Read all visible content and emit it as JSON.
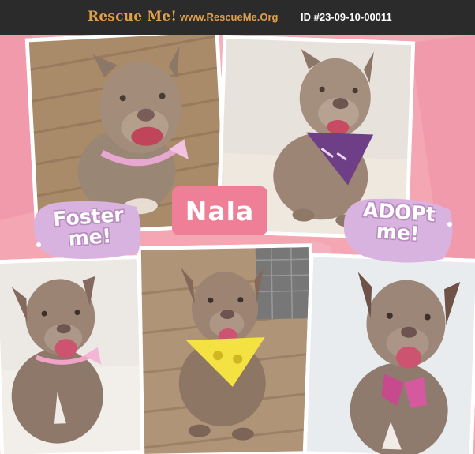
{
  "header": {
    "brand": "Rescue Me!",
    "site": "www.RescueMe.Org",
    "pet_id": "ID #23-09-10-00011"
  },
  "collage": {
    "name_label": "Nala",
    "foster_bubble": [
      "Foster",
      "me!"
    ],
    "adopt_bubble": [
      "ADOPt",
      "me!"
    ]
  },
  "colors": {
    "header_bg": "#2b2b2b",
    "brand_text": "#e0a04b",
    "collage_pink": "#f4a6b2",
    "label_pink": "#ef7f96",
    "bubble_purple": "#d9b3e0"
  }
}
